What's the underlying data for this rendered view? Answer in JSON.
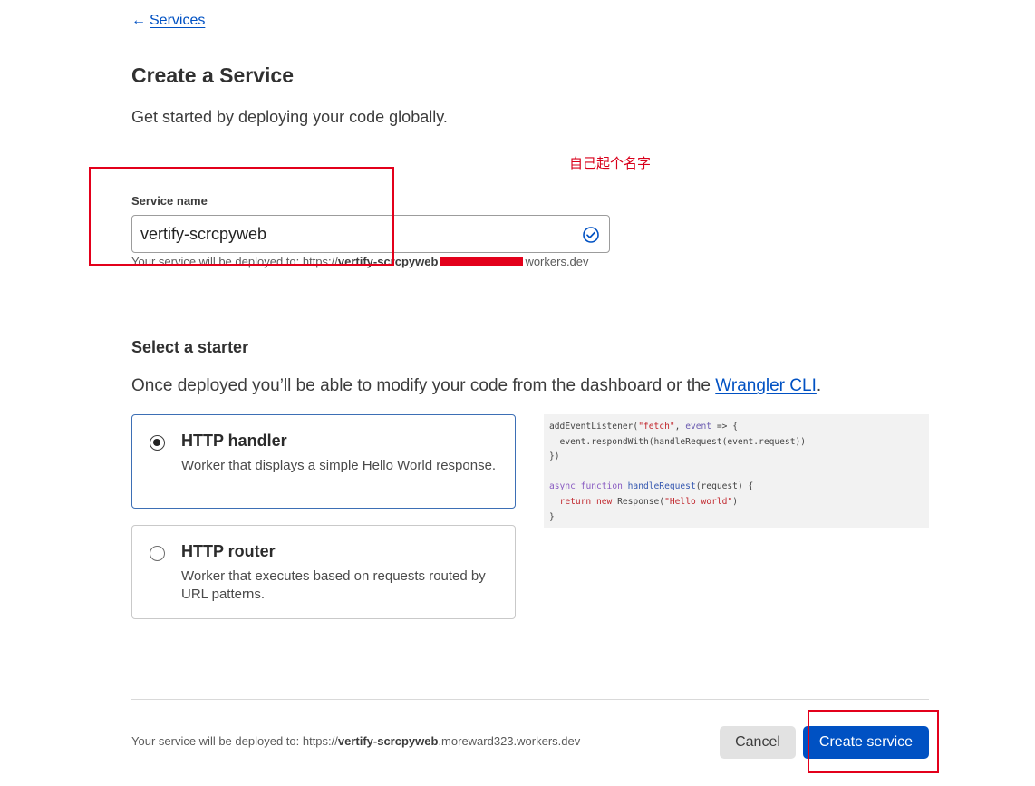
{
  "nav": {
    "back_arrow": "←",
    "back_label": "Services"
  },
  "header": {
    "title": "Create a Service",
    "subtitle": "Get started by deploying your code globally."
  },
  "annotation": {
    "note": "自己起个名字",
    "color": "#e3001b"
  },
  "service_name": {
    "label": "Service name",
    "value": "vertify-scrcpyweb",
    "status_icon": "check-circle-icon",
    "hint_prefix": "Your service will be deployed to: https://",
    "hint_bold": "vertify-scrcpyweb",
    "hint_suffix": "workers.dev"
  },
  "starter": {
    "title": "Select a starter",
    "description": "Once deployed you’ll be able to modify your code from the dashboard or the ",
    "link_label": "Wrangler CLI",
    "link_suffix": ".",
    "options": [
      {
        "title": "HTTP handler",
        "description": "Worker that displays a simple Hello World response.",
        "selected": true
      },
      {
        "title": "HTTP router",
        "description": "Worker that executes based on requests routed by URL patterns.",
        "selected": false
      }
    ]
  },
  "code": {
    "l1_a": "addEventListener(",
    "l1_str": "\"fetch\"",
    "l1_b": ", ",
    "l1_var": "event",
    "l1_c": " => {",
    "l2": "  event.respondWith(handleRequest(event.request))",
    "l3": "})",
    "l5_kw1": "async",
    "l5_kw2": " function",
    "l5_fn": " handleRequest",
    "l5_rest": "(request) {",
    "l6_kw1": "  return",
    "l6_kw2": " new",
    "l6_a": " Response(",
    "l6_str": "\"Hello world\"",
    "l6_b": ")",
    "l7": "}"
  },
  "footer": {
    "hint_prefix": "Your service will be deployed to: https://",
    "hint_bold": "vertify-scrcpyweb",
    "hint_suffix": ".moreward323.workers.dev",
    "cancel_label": "Cancel",
    "create_label": "Create service"
  },
  "colors": {
    "accent": "#0051c3",
    "valid": "#0051c3",
    "annotation": "#e3001b"
  }
}
